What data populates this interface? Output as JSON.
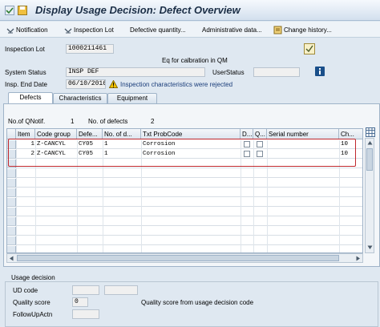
{
  "window": {
    "title": "Display Usage Decision: Defect Overview"
  },
  "toolbar": {
    "notification": "Notification",
    "inspection_lot": "Inspection Lot",
    "defective_quantity": "Defective quantity...",
    "administrative_data": "Administrative data...",
    "change_history": "Change history..."
  },
  "header": {
    "inspection_lot_label": "Inspection Lot",
    "inspection_lot_value": "1000211461",
    "description": "Eq for calbration in QM",
    "system_status_label": "System Status",
    "system_status_value": "INSP DEF",
    "user_status_label": "UserStatus",
    "user_status_value": "",
    "insp_end_date_label": "Insp. End Date",
    "insp_end_date_value": "06/10/2016",
    "warning_text": "Inspection characteristics were rejected"
  },
  "tabs": [
    {
      "label": "Defects",
      "active": true
    },
    {
      "label": "Characteristics",
      "active": false
    },
    {
      "label": "Equipment",
      "active": false
    }
  ],
  "summary": {
    "qnotif_label": "No.of QNotif.",
    "qnotif_value": "1",
    "defects_label": "No. of defects",
    "defects_value": "2"
  },
  "grid": {
    "columns": [
      "Item",
      "Code group",
      "Defe...",
      "No. of d...",
      "Txt ProbCode",
      "D...",
      "Q...",
      "Serial number",
      "Ch..."
    ],
    "rows": [
      {
        "item": "1",
        "code_group": "Z-CANCYL",
        "defect": "CY05",
        "count": "1",
        "text": "Corrosion",
        "serial": "",
        "ch": "10"
      },
      {
        "item": "2",
        "code_group": "Z-CANCYL",
        "defect": "CY05",
        "count": "1",
        "text": "Corrosion",
        "serial": "",
        "ch": "10"
      }
    ]
  },
  "usage_decision": {
    "title": "Usage decision",
    "ud_code_label": "UD code",
    "ud_code_value": "",
    "quality_score_label": "Quality score",
    "quality_score_value": "0",
    "quality_score_text": "Quality score from usage decision code",
    "followup_label": "FollowUpActn",
    "followup_value": ""
  },
  "colors": {
    "highlight": "#c0282d",
    "accent": "#1a4f8a",
    "warning": "#e3b100"
  }
}
